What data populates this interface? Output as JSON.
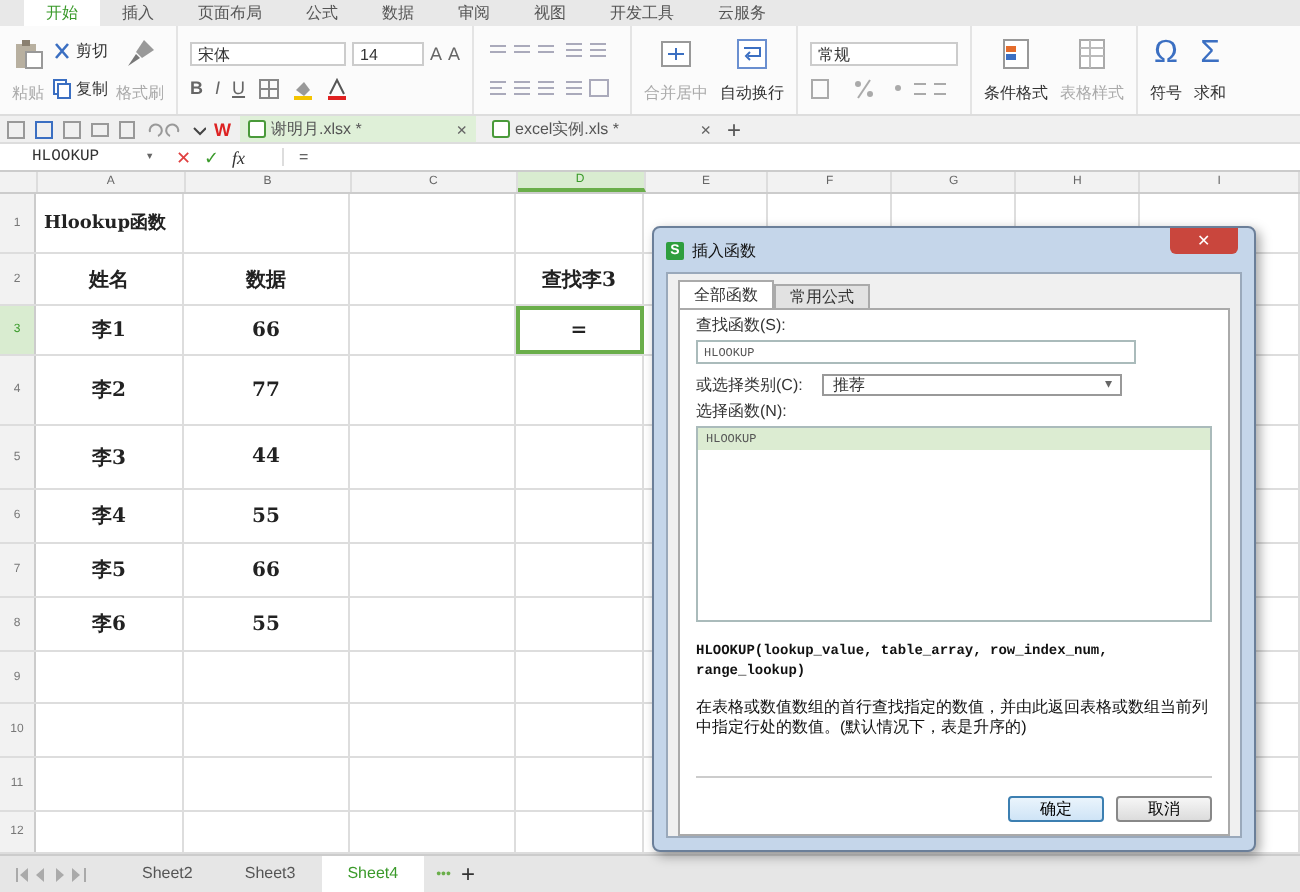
{
  "menu_tabs": [
    {
      "label": "开始",
      "selected": true
    },
    {
      "label": "插入",
      "selected": false
    },
    {
      "label": "页面布局",
      "selected": false
    },
    {
      "label": "公式",
      "selected": false
    },
    {
      "label": "数据",
      "selected": false
    },
    {
      "label": "审阅",
      "selected": false
    },
    {
      "label": "视图",
      "selected": false
    },
    {
      "label": "开发工具",
      "selected": false
    },
    {
      "label": "云服务",
      "selected": false
    }
  ],
  "ribbon": {
    "grow_font": "A",
    "shrink_font": "A",
    "bold": "B",
    "italic": "I",
    "underline": "U",
    "symbol_glyph": "Ω",
    "sum_glyph": "Σ",
    "paste": "粘贴",
    "cut": "剪切",
    "copy": "复制",
    "format_painter": "格式刷",
    "font": "宋体",
    "font_size": "14",
    "merge": "合并居中",
    "wrap": "自动换行",
    "number_format": "常规",
    "conditional_format": "条件格式",
    "table_style": "表格样式",
    "symbol": "符号",
    "sum": "求和"
  },
  "tab_bar": {
    "app_logo": "W",
    "new_tab": "+"
  },
  "doc_tabs": [
    {
      "label": "谢明月.xlsx *",
      "close": "×",
      "selected": true
    },
    {
      "label": "excel实例.xls *",
      "close": "×",
      "selected": false
    }
  ],
  "formula_bar": {
    "name_box": "HLOOKUP",
    "dropdown": "▾",
    "cancel": "✕",
    "confirm": "✓",
    "function": "fx",
    "value": "="
  },
  "columns": [
    {
      "label": "A",
      "selected": false
    },
    {
      "label": "B",
      "selected": false
    },
    {
      "label": "C",
      "selected": false
    },
    {
      "label": "D",
      "selected": true
    },
    {
      "label": "E",
      "selected": false
    },
    {
      "label": "F",
      "selected": false
    },
    {
      "label": "G",
      "selected": false
    },
    {
      "label": "H",
      "selected": false
    },
    {
      "label": "I",
      "selected": false
    }
  ],
  "rows": [
    {
      "number": "1",
      "selected": false,
      "col_a": "Hlookup函数"
    },
    {
      "number": "2",
      "selected": false,
      "col_a": "姓名",
      "col_b": "数据",
      "col_d": "查找李3"
    },
    {
      "number": "3",
      "selected": true,
      "col_a": "李1",
      "col_b": "66",
      "col_d": "="
    },
    {
      "number": "4",
      "selected": false,
      "col_a": "李2",
      "col_b": "77"
    },
    {
      "number": "5",
      "selected": false,
      "col_a": "李3",
      "col_b": "44"
    },
    {
      "number": "6",
      "selected": false,
      "col_a": "李4",
      "col_b": "55"
    },
    {
      "number": "7",
      "selected": false,
      "col_a": "李5",
      "col_b": "66"
    },
    {
      "number": "8",
      "selected": false,
      "col_a": "李6",
      "col_b": "55"
    },
    {
      "number": "9",
      "selected": false
    },
    {
      "number": "10",
      "selected": false
    },
    {
      "number": "11",
      "selected": false
    },
    {
      "number": "12",
      "selected": false
    }
  ],
  "dialog": {
    "logo": "S",
    "close": "✕",
    "dropdown": "▾",
    "title": "插入函数",
    "tabs": [
      {
        "label": "全部函数",
        "selected": true
      },
      {
        "label": "常用公式",
        "selected": false
      }
    ],
    "search_label": "查找函数(S):",
    "search_value": "HLOOKUP",
    "category_label": "或选择类别(C):",
    "category": "推荐",
    "list_label": "选择函数(N):",
    "functions": [
      {
        "label": "HLOOKUP",
        "selected": true
      }
    ],
    "signature": "HLOOKUP(lookup_value, table_array, row_index_num, range_lookup)",
    "description": "在表格或数值数组的首行查找指定的数值，并由此返回表格或数组当前列中指定行处的数值。(默认情况下，表是升序的)",
    "ok": "确定",
    "cancel": "取消"
  },
  "sheet_bar": {
    "more": "•••",
    "add": "+"
  },
  "sheet_tabs": [
    {
      "label": "Sheet2",
      "selected": false
    },
    {
      "label": "Sheet3",
      "selected": false
    },
    {
      "label": "Sheet4",
      "selected": true
    }
  ]
}
